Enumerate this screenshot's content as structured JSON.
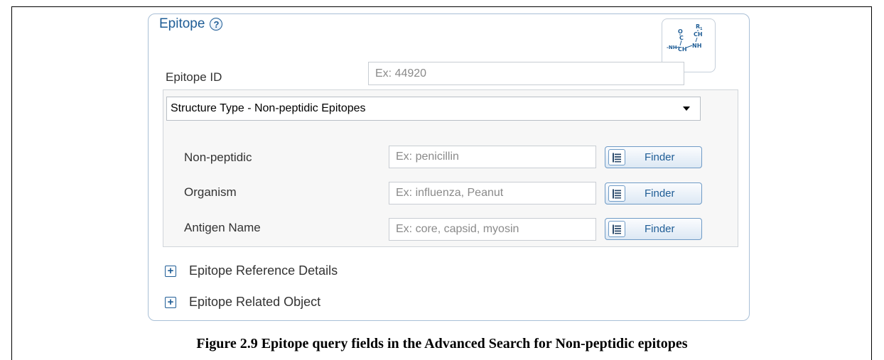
{
  "panel": {
    "title": "Epitope",
    "help_icon": "question-circle-icon",
    "structure_icon": "chemical-structure-icon",
    "accent_color": "#1f5d96"
  },
  "epitope_id": {
    "label": "Epitope ID",
    "placeholder": "Ex: 44920"
  },
  "structure_type": {
    "selected": "Structure Type - Non-peptidic Epitopes"
  },
  "fields": [
    {
      "label": "Non-peptidic",
      "placeholder": "Ex: penicillin",
      "finder_label": "Finder"
    },
    {
      "label": "Organism",
      "placeholder": "Ex: influenza, Peanut",
      "finder_label": "Finder"
    },
    {
      "label": "Antigen Name",
      "placeholder": "Ex: core, capsid, myosin",
      "finder_label": "Finder"
    }
  ],
  "expanders": [
    {
      "label": "Epitope Reference Details",
      "icon": "plus-box-icon"
    },
    {
      "label": "Epitope Related Object",
      "icon": "plus-box-icon"
    }
  ],
  "caption": "Figure 2.9  Epitope query fields in the Advanced Search for Non-peptidic epitopes"
}
